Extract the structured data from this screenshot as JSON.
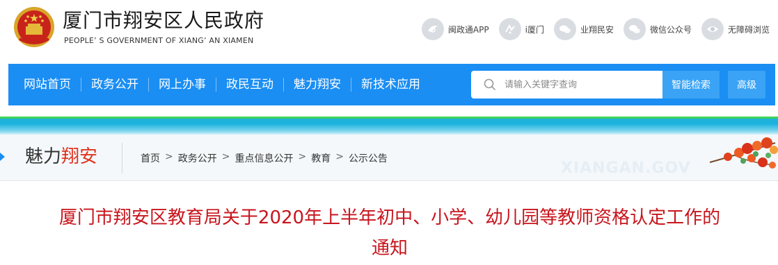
{
  "header": {
    "title_cn": "厦门市翔安区人民政府",
    "title_en": "PEOPLE’ S GOVERNMENT OF XIANG’ AN XIAMEN",
    "quick_links": [
      {
        "label": "闽政通APP",
        "icon": "mzt-app-icon"
      },
      {
        "label": "i厦门",
        "icon": "ixiamen-icon"
      },
      {
        "label": "业翔民安",
        "icon": "chat-icon"
      },
      {
        "label": "微信公众号",
        "icon": "wechat-icon"
      },
      {
        "label": "无障碍浏览",
        "icon": "eye-icon"
      }
    ]
  },
  "nav": {
    "items": [
      "网站首页",
      "政务公开",
      "网上办事",
      "政民互动",
      "魅力翔安",
      "新技术应用"
    ],
    "search_placeholder": "请输入关键字查询",
    "smart_search_label": "智能检索",
    "advanced_label": "高级"
  },
  "section": {
    "title_part1": "魅力",
    "title_part2": "翔安",
    "watermark": "XIANGAN.GOV",
    "breadcrumb": [
      "首页",
      "政务公开",
      "重点信息公开",
      "教育",
      "公示公告"
    ],
    "separator": ">"
  },
  "article": {
    "title_line1": "厦门市翔安区教育局关于2020年上半年初中、小学、幼儿园等教师资格认定工作的",
    "title_line2": "通知"
  },
  "colors": {
    "nav_blue": "#1a8ef3",
    "button_blue": "#3aa3f5",
    "title_red": "#c8151d",
    "accent_red": "#e0321c"
  }
}
